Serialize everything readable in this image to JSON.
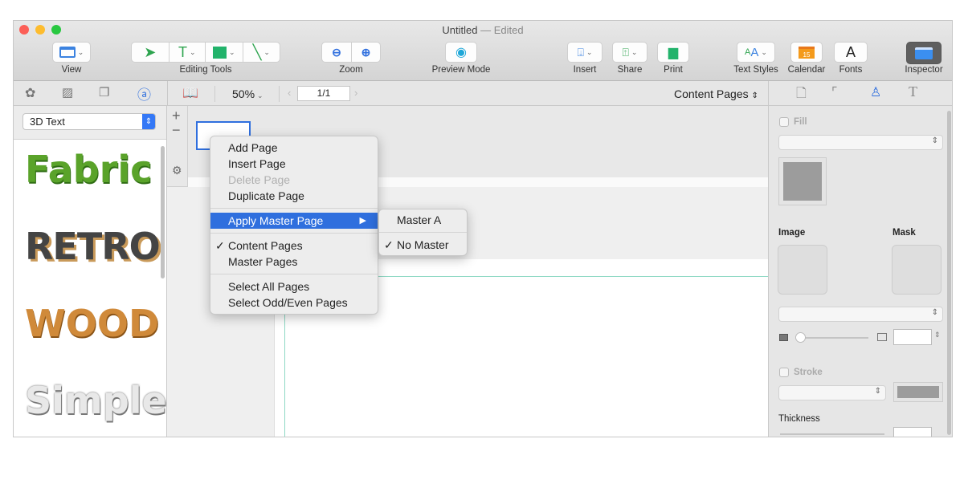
{
  "window": {
    "title": "Untitled",
    "status": "— Edited"
  },
  "toolbar": {
    "view": "View",
    "editing_tools": "Editing Tools",
    "zoom": "Zoom",
    "preview_mode": "Preview Mode",
    "insert": "Insert",
    "share": "Share",
    "print": "Print",
    "text_styles": "Text Styles",
    "calendar": "Calendar",
    "calendar_day": "15",
    "fonts": "Fonts",
    "fonts_glyph": "A",
    "inspector": "Inspector"
  },
  "secondary_bar": {
    "zoom_value": "50%",
    "page_field": "1/1",
    "page_type": "Content Pages"
  },
  "sidebar": {
    "category": "3D Text",
    "samples": [
      "Fabric",
      "RETRO",
      "WOOD",
      "Simple"
    ]
  },
  "context_menu": {
    "items": [
      {
        "label": "Add Page"
      },
      {
        "label": "Insert Page"
      },
      {
        "label": "Delete Page",
        "disabled": true
      },
      {
        "label": "Duplicate Page"
      },
      {
        "label": "Apply Master Page",
        "highlighted": true
      },
      {
        "label": "Content Pages",
        "checked": true
      },
      {
        "label": "Master Pages"
      },
      {
        "label": "Select All Pages"
      },
      {
        "label": "Select Odd/Even Pages"
      }
    ]
  },
  "submenu": {
    "items": [
      {
        "label": "Master A"
      },
      {
        "label": "No Master",
        "checked": true
      }
    ]
  },
  "inspector": {
    "fill": "Fill",
    "image": "Image",
    "mask": "Mask",
    "stroke": "Stroke",
    "thickness": "Thickness"
  },
  "colors": {
    "accent": "#2f6fde",
    "guide": "#8fd9c4",
    "fill_swatch": "#9c9c9c"
  }
}
